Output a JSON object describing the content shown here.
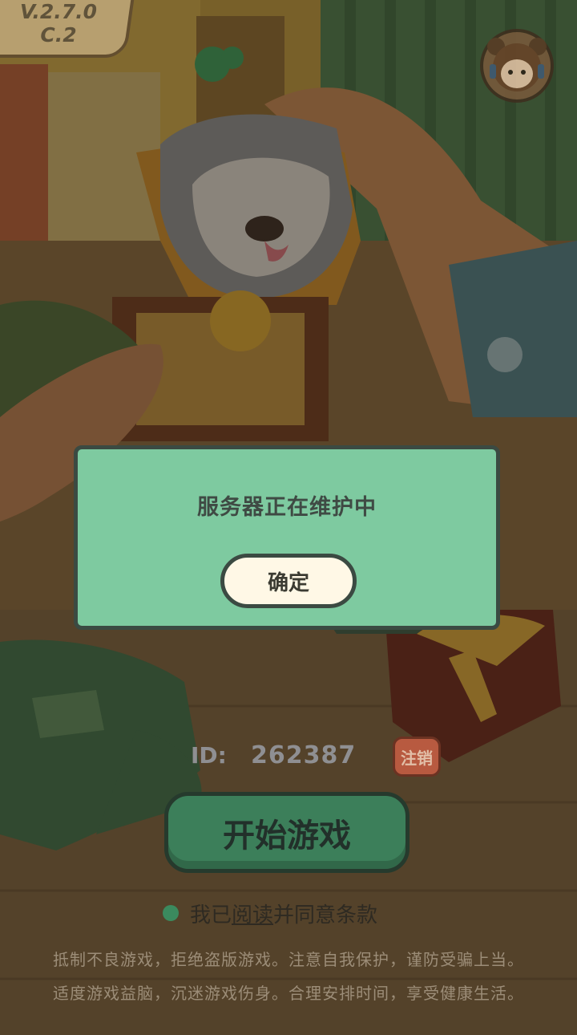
{
  "version": {
    "line1": "V.2.7.0",
    "line2": "C.2"
  },
  "support": {
    "icon": "customer-service-avatar-icon"
  },
  "modal": {
    "message": "服务器正在维护中",
    "confirm_label": "确定"
  },
  "account": {
    "id_label": "ID:",
    "id_value": "262387",
    "logout_label": "注销"
  },
  "start_button_label": "开始游戏",
  "agreement": {
    "prefix": "我已",
    "link": "阅读",
    "suffix": "并同意条款"
  },
  "health_notice": {
    "line1": "抵制不良游戏，拒绝盗版游戏。注意自我保护，谨防受骗上当。",
    "line2": "适度游戏益脑，沉迷游戏伤身。合理安排时间，享受健康生活。"
  },
  "colors": {
    "modal_bg": "#7ecaa0",
    "start_button": "#3c7f5a",
    "logout_button": "#b85a40"
  }
}
